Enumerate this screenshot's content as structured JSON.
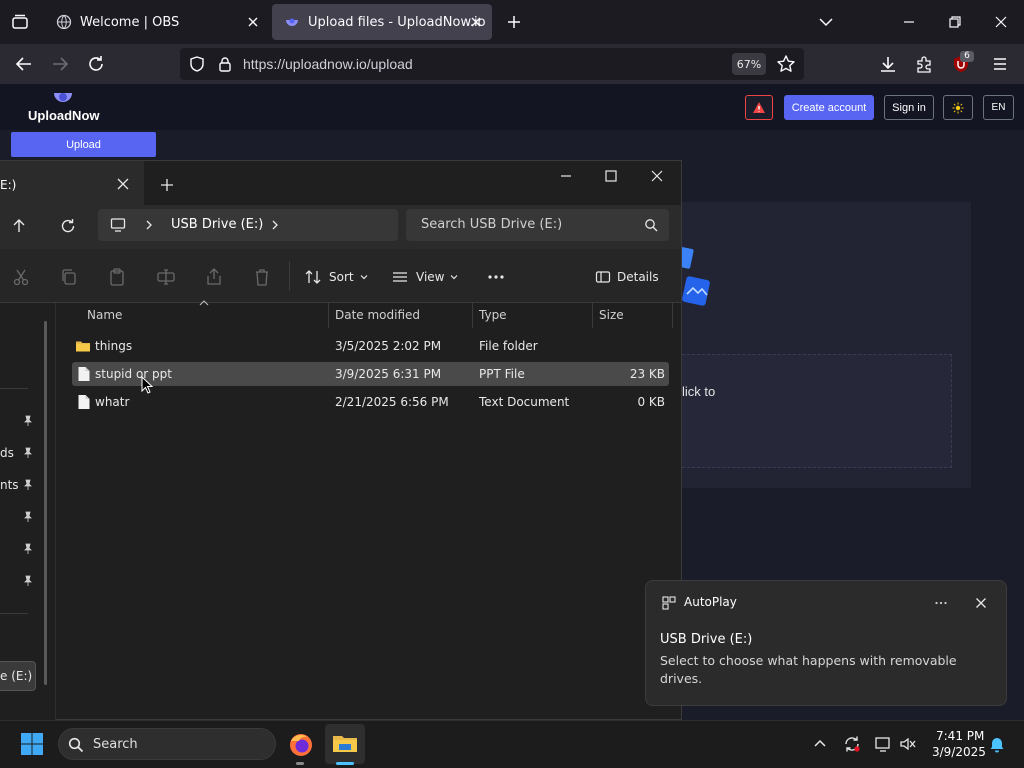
{
  "browser": {
    "tabs": [
      {
        "title": "Welcome | OBS",
        "active": false
      },
      {
        "title": "Upload files - UploadNow.io",
        "active": true
      }
    ],
    "url": "https://uploadnow.io/upload",
    "zoom": "67%",
    "extension_badge": "6"
  },
  "site": {
    "logo": "UploadNow",
    "upload_nav": "Upload",
    "create_account": "Create account",
    "sign_in": "Sign in",
    "language": "EN",
    "drop_hint": "lick to",
    "accent": "#5865f2"
  },
  "explorer": {
    "tab_title": "E:)",
    "breadcrumb": "USB Drive (E:)",
    "search_placeholder": "Search USB Drive (E:)",
    "toolbar": {
      "sort": "Sort",
      "view": "View",
      "details": "Details"
    },
    "columns": {
      "name": "Name",
      "date": "Date modified",
      "type": "Type",
      "size": "Size"
    },
    "files": [
      {
        "name": "things",
        "date": "3/5/2025 2:02 PM",
        "type": "File folder",
        "size": "",
        "icon": "folder-icon",
        "selected": false
      },
      {
        "name": "stupid or ppt",
        "date": "3/9/2025 6:31 PM",
        "type": "PPT File",
        "size": "23 KB",
        "icon": "file-icon",
        "selected": true
      },
      {
        "name": "whatr",
        "date": "2/21/2025 6:56 PM",
        "type": "Text Document",
        "size": "0 KB",
        "icon": "file-icon",
        "selected": false
      }
    ],
    "sidebar_labels": [
      "ds",
      "nts",
      "e (E:)"
    ]
  },
  "autoplay": {
    "app": "AutoPlay",
    "title": "USB Drive (E:)",
    "message": "Select to choose what happens with removable drives."
  },
  "taskbar": {
    "search": "Search",
    "time": "7:41 PM",
    "date": "3/9/2025"
  }
}
